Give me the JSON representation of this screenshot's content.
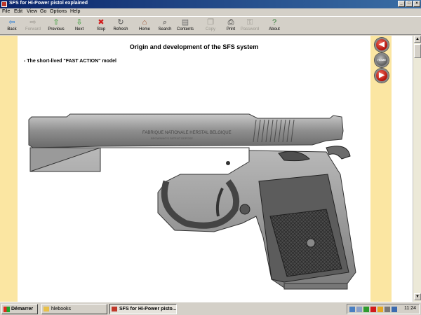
{
  "window": {
    "title": "SFS for Hi-Power pistol explained"
  },
  "menu": [
    "File",
    "Edit",
    "View",
    "Go",
    "Options",
    "Help"
  ],
  "toolbar": [
    {
      "label": "Back",
      "icon": "back-arrow-icon",
      "glyph": "⇦",
      "color": "#2a7fd6",
      "enabled": true
    },
    {
      "label": "Forward",
      "icon": "forward-arrow-icon",
      "glyph": "⇨",
      "color": "#9a978f",
      "enabled": false
    },
    {
      "label": "Previous",
      "icon": "up-arrow-icon",
      "glyph": "⇧",
      "color": "#2e9b2e",
      "enabled": true
    },
    {
      "label": "Next",
      "icon": "down-arrow-icon",
      "glyph": "⇩",
      "color": "#2e9b2e",
      "enabled": true
    },
    {
      "label": "Stop",
      "icon": "stop-icon",
      "glyph": "✖",
      "color": "#d21a1a",
      "enabled": true
    },
    {
      "label": "Refresh",
      "icon": "refresh-icon",
      "glyph": "↻",
      "color": "#555555",
      "enabled": true
    },
    {
      "label": "Home",
      "icon": "home-icon",
      "glyph": "⌂",
      "color": "#a0522d",
      "enabled": true
    },
    {
      "label": "Search",
      "icon": "search-icon",
      "glyph": "⌕",
      "color": "#333333",
      "enabled": true
    },
    {
      "label": "Contents",
      "icon": "contents-icon",
      "glyph": "▤",
      "color": "#6d6d6d",
      "enabled": true
    },
    {
      "label": "Copy",
      "icon": "copy-icon",
      "glyph": "❐",
      "color": "#9a978f",
      "enabled": false
    },
    {
      "label": "Print",
      "icon": "print-icon",
      "glyph": "⎙",
      "color": "#333333",
      "enabled": true
    },
    {
      "label": "Password",
      "icon": "key-icon",
      "glyph": "⚿",
      "color": "#9a978f",
      "enabled": false
    },
    {
      "label": "About",
      "icon": "about-icon",
      "glyph": "?",
      "color": "#2e7d32",
      "enabled": true
    }
  ],
  "page": {
    "heading": "Origin and development of the SFS system",
    "section": "- The short-lived \"FAST ACTION\" model",
    "slide_text_1": "FABRIQUE NATIONALE HERSTAL BELGIQUE",
    "slide_text_2": "BROWNING'S PATENT DEPOSE"
  },
  "side_nav": [
    {
      "icon": "previous-page-icon",
      "glyph": "◀"
    },
    {
      "icon": "home-page-icon",
      "glyph": "HOME"
    },
    {
      "icon": "next-page-icon",
      "glyph": "▶"
    }
  ],
  "taskbar": {
    "start_label": "Démarrer",
    "tasks": [
      {
        "label": "hlebooks",
        "active": false
      },
      {
        "label": "SFS for Hi-Power pisto...",
        "active": true
      }
    ],
    "clock": "11:24"
  },
  "colors": {
    "margin": "#fbe6a2",
    "titlebar": "#0a246a"
  }
}
